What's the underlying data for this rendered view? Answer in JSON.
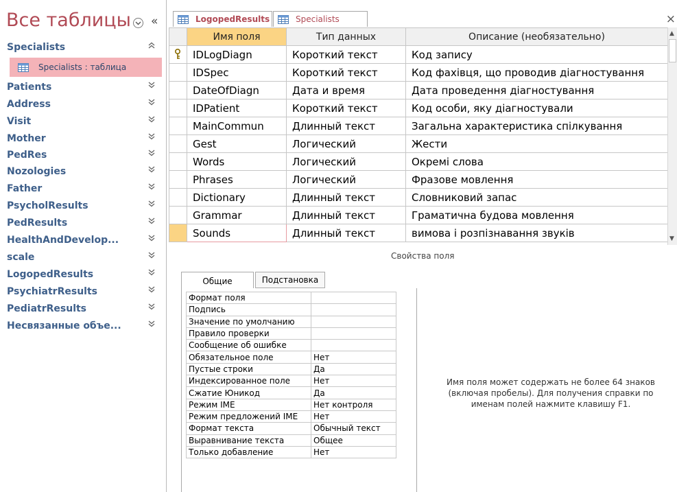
{
  "nav": {
    "title": "Все таблицы",
    "collapse_glyph": "«",
    "filter_icon": "chevron-down-circle-icon",
    "groups": [
      {
        "label": "Specialists",
        "expanded": true
      },
      {
        "label": "Patients"
      },
      {
        "label": "Address"
      },
      {
        "label": "Visit"
      },
      {
        "label": "Mother"
      },
      {
        "label": "PedRes"
      },
      {
        "label": "Nozologies"
      },
      {
        "label": "Father"
      },
      {
        "label": "PsycholResults"
      },
      {
        "label": "PedResults"
      },
      {
        "label": "HealthAndDevelop..."
      },
      {
        "label": "scale"
      },
      {
        "label": "LogopedResults"
      },
      {
        "label": "PsychiatrResults"
      },
      {
        "label": "PediatrResults"
      },
      {
        "label": "Несвязанные объе..."
      }
    ],
    "selected_item": "Specialists : таблица",
    "chev_collapsed": "»",
    "chev_expanded": "«"
  },
  "tabs": [
    {
      "label": "LogopedResults",
      "active": true
    },
    {
      "label": "Specialists",
      "active": false
    }
  ],
  "tab_close": "×",
  "grid": {
    "headers": [
      "Имя поля",
      "Тип данных",
      "Описание (необязательно)"
    ],
    "rows": [
      {
        "name": "IDLogDiagn",
        "type": "Короткий текст",
        "desc": "Код запису",
        "key": true
      },
      {
        "name": "IDSpec",
        "type": "Короткий текст",
        "desc": "Код фахівця, що проводив діагностування"
      },
      {
        "name": "DateOfDiagn",
        "type": "Дата и время",
        "desc": "Дата проведення діагностування"
      },
      {
        "name": "IDPatient",
        "type": "Короткий текст",
        "desc": "Код особи, яку діагностували"
      },
      {
        "name": "MainCommun",
        "type": "Длинный текст",
        "desc": "Загальна характеристика спілкування"
      },
      {
        "name": "Gest",
        "type": "Логический",
        "desc": "Жести"
      },
      {
        "name": "Words",
        "type": "Логический",
        "desc": "Окремі слова"
      },
      {
        "name": "Phrases",
        "type": "Логический",
        "desc": "Фразове мовлення"
      },
      {
        "name": "Dictionary",
        "type": "Длинный текст",
        "desc": "Словниковий запас"
      },
      {
        "name": "Grammar",
        "type": "Длинный текст",
        "desc": "Граматична будова мовлення"
      },
      {
        "name": "Sounds",
        "type": "Длинный текст",
        "desc": "вимова і розпізнавання звуків",
        "current": true
      }
    ]
  },
  "field_properties_caption": "Свойства поля",
  "prop_tabs": [
    "Общие",
    "Подстановка"
  ],
  "properties": [
    {
      "label": "Формат поля",
      "value": ""
    },
    {
      "label": "Подпись",
      "value": ""
    },
    {
      "label": "Значение по умолчанию",
      "value": ""
    },
    {
      "label": "Правило проверки",
      "value": ""
    },
    {
      "label": "Сообщение об ошибке",
      "value": ""
    },
    {
      "label": "Обязательное поле",
      "value": "Нет"
    },
    {
      "label": "Пустые строки",
      "value": "Да"
    },
    {
      "label": "Индексированное поле",
      "value": "Нет"
    },
    {
      "label": "Сжатие Юникод",
      "value": "Да"
    },
    {
      "label": "Режим IME",
      "value": "Нет контроля"
    },
    {
      "label": "Режим предложений IME",
      "value": "Нет"
    },
    {
      "label": "Формат текста",
      "value": "Обычный текст"
    },
    {
      "label": "Выравнивание текста",
      "value": "Общее"
    },
    {
      "label": "Только добавление",
      "value": "Нет"
    }
  ],
  "help_text": "Имя поля может содержать не более 64 знаков (включая пробелы). Для получения справки по именам полей нажмите клавишу F1.",
  "colors": {
    "title": "#b14a55",
    "group": "#3e5f8a",
    "selected_bg": "#f4b3b8",
    "current_row": "#fbd484"
  }
}
